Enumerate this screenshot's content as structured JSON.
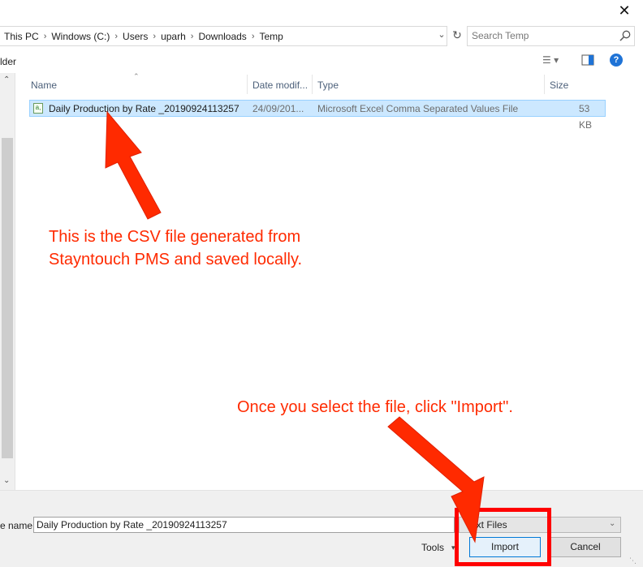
{
  "window": {
    "close_glyph": "✕"
  },
  "address_bar": {
    "crumbs": [
      "This PC",
      "Windows (C:)",
      "Users",
      "uparh",
      "Downloads",
      "Temp"
    ],
    "separator": "›"
  },
  "search": {
    "placeholder": "Search Temp",
    "icon": "search-icon"
  },
  "toolbar": {
    "new_folder_partial": "lder",
    "help_glyph": "?"
  },
  "file_list": {
    "columns": [
      "Name",
      "Date modif...",
      "Type",
      "Size"
    ],
    "rows": [
      {
        "name": "Daily Production by Rate _20190924113257",
        "date": "24/09/201...",
        "type": "Microsoft Excel Comma Separated Values File",
        "size": "53 KB",
        "icon": "csv-file-icon",
        "selected": true
      }
    ]
  },
  "annotations": {
    "csv_note_line1": "This is the CSV file generated from",
    "csv_note_line2": "Stayntouch PMS and saved locally.",
    "import_note": "Once you select the file, click \"Import\".",
    "color": "#ff2a00",
    "highlight_color": "#ff0000"
  },
  "bottom": {
    "file_name_label": "e name:",
    "file_name_value": "Daily Production by Rate _20190924113257",
    "file_type_value": "ext Files",
    "tools_label": "Tools",
    "import_label": "Import",
    "cancel_label": "Cancel"
  }
}
